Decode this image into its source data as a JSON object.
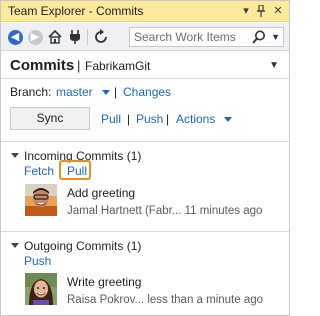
{
  "window": {
    "title": "Team Explorer - Commits",
    "pin_glyph": "▾",
    "pin_icon": "pin-icon",
    "close_glyph": "✕"
  },
  "toolbar": {
    "search_placeholder": "Search Work Items",
    "icons": [
      "back-icon",
      "forward-icon",
      "home-icon",
      "connect-icon",
      "refresh-icon",
      "search-icon"
    ]
  },
  "header": {
    "title": "Commits",
    "separator": "|",
    "repo": "FabrikamGit"
  },
  "branch": {
    "label": "Branch:",
    "name": "master",
    "separator": "|",
    "changes_link": "Changes"
  },
  "actions": {
    "sync": "Sync",
    "pull": "Pull",
    "sep1": "|",
    "push": "Push",
    "sep2": "|",
    "actions": "Actions"
  },
  "incoming": {
    "title": "Incoming Commits (1)",
    "fetch": "Fetch",
    "pull": "Pull",
    "commits": [
      {
        "message": "Add greeting",
        "meta": "Jamal Hartnett (Fabr... 11 minutes ago"
      }
    ]
  },
  "outgoing": {
    "title": "Outgoing Commits (1)",
    "push": "Push",
    "commits": [
      {
        "message": "Write greeting",
        "meta": "Raisa Pokrov... less than a minute ago"
      }
    ]
  },
  "colors": {
    "accent": "#1e64c8",
    "titlebar": "#fde99c",
    "highlight": "#f08c1a"
  }
}
